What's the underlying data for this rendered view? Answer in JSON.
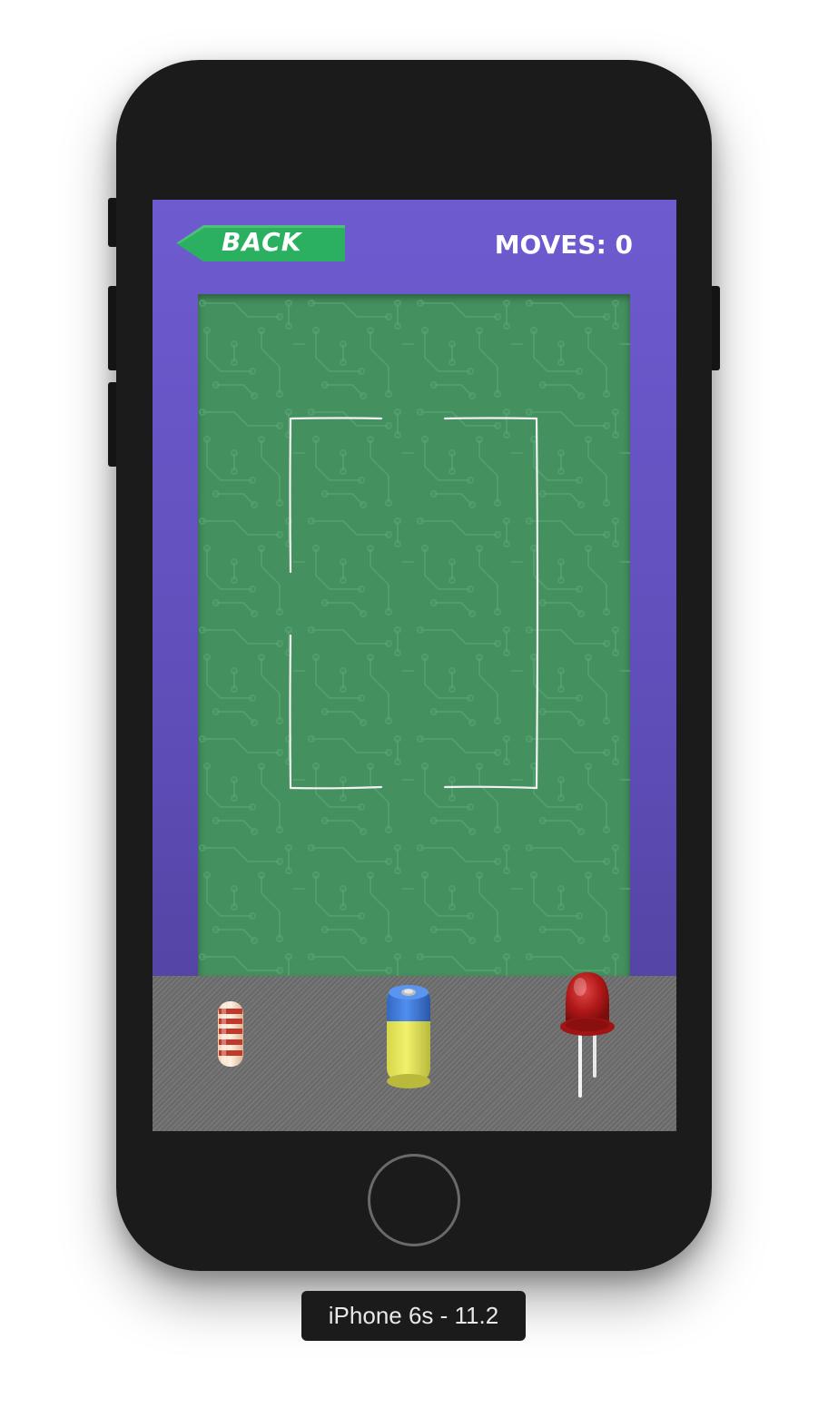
{
  "header": {
    "back_label": "BACK",
    "moves_label": "MOVES: 0",
    "moves_count": 0
  },
  "tray": {
    "components": [
      {
        "name": "resistor",
        "icon": "resistor-icon"
      },
      {
        "name": "battery",
        "icon": "battery-icon"
      },
      {
        "name": "led",
        "icon": "led-icon"
      }
    ]
  },
  "device": {
    "label": "iPhone 6s - 11.2"
  },
  "colors": {
    "background": "#6e5bd0",
    "board": "#44905f",
    "back_button": "#2bb062",
    "tray": "#6e6e6e",
    "wire": "#ffffff",
    "battery_body": "#e3e35a",
    "battery_cap": "#3a7bd5",
    "led": "#b01818"
  }
}
